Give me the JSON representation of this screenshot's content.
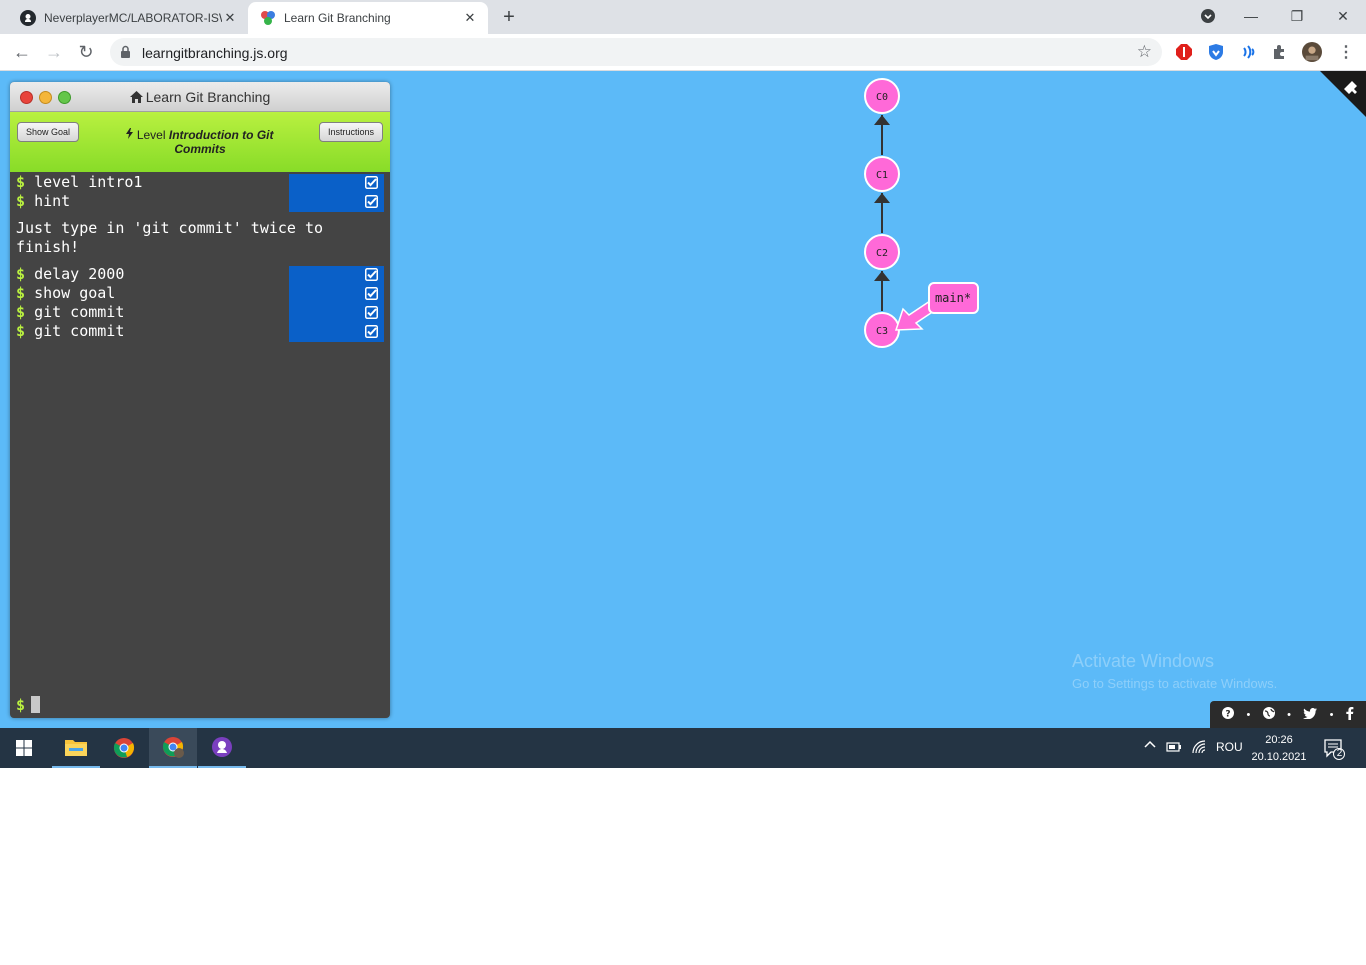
{
  "browser": {
    "tabs": [
      {
        "title": "NeverplayerMC/LABORATOR-ISW",
        "favicon": "github-icon",
        "active": false
      },
      {
        "title": "Learn Git Branching",
        "favicon": "lgb-icon",
        "active": true
      }
    ],
    "url": "learngitbranching.js.org"
  },
  "terminal": {
    "window_title": "Learn Git Branching",
    "show_goal_label": "Show Goal",
    "instructions_label": "Instructions",
    "level_prefix": "Level",
    "level_name": "Introduction to Git Commits",
    "prompt_symbol": "$",
    "commands_top": [
      "level intro1",
      "hint"
    ],
    "message": "Just type in 'git commit' twice to finish!",
    "commands_bottom": [
      "delay 2000",
      "show goal",
      "git commit",
      "git commit"
    ]
  },
  "graph": {
    "commits": [
      "C0",
      "C1",
      "C2",
      "C3"
    ],
    "branch_label": "main*",
    "node_color": "#ff69d8",
    "background": "#5cbaf8"
  },
  "footer_icons": [
    "help-icon",
    "globe-icon",
    "twitter-icon",
    "facebook-icon"
  ],
  "watermark": {
    "title": "Activate Windows",
    "subtitle": "Go to Settings to activate Windows."
  },
  "taskbar": {
    "language": "ROU",
    "time": "20:26",
    "date": "20.10.2021",
    "notification_count": "2"
  }
}
